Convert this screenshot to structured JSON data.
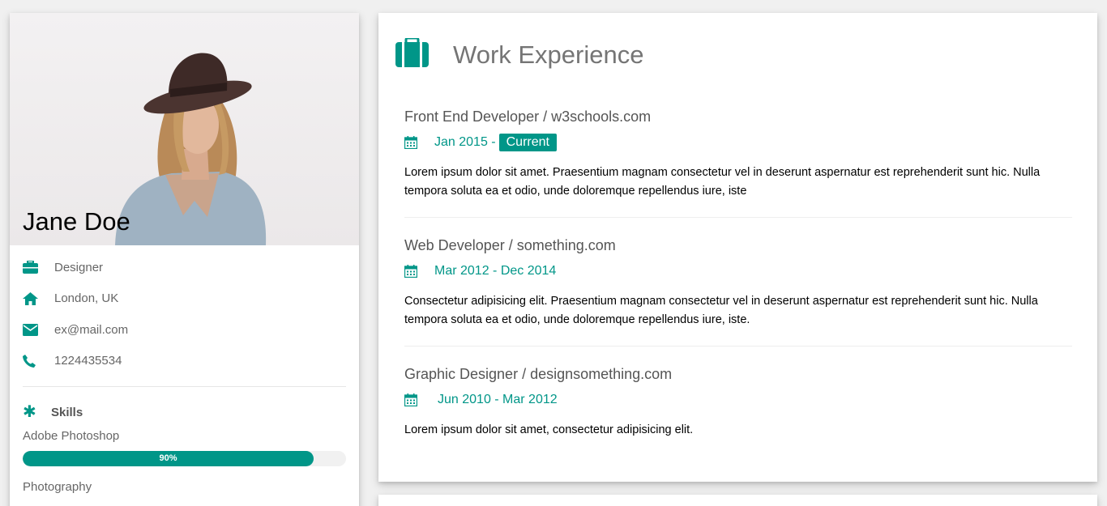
{
  "profile": {
    "name": "Jane Doe",
    "info": [
      {
        "icon": "briefcase-icon",
        "text": "Designer"
      },
      {
        "icon": "home-icon",
        "text": "London, UK"
      },
      {
        "icon": "envelope-icon",
        "text": "ex@mail.com"
      },
      {
        "icon": "phone-icon",
        "text": "1224435534"
      }
    ],
    "skills_label": "Skills",
    "skills": [
      {
        "name": "Adobe Photoshop",
        "percent": 90,
        "label": "90%"
      },
      {
        "name": "Photography"
      }
    ]
  },
  "work": {
    "title": "Work Experience",
    "jobs": [
      {
        "title": "Front End Developer / w3schools.com",
        "date": "Jan 2015 - ",
        "tag": "Current",
        "desc": "Lorem ipsum dolor sit amet. Praesentium magnam consectetur vel in deserunt aspernatur est reprehenderit sunt hic. Nulla tempora soluta ea et odio, unde doloremque repellendus iure, iste"
      },
      {
        "title": "Web Developer / something.com",
        "date": "Mar 2012 - Dec 2014",
        "desc": "Consectetur adipisicing elit. Praesentium magnam consectetur vel in deserunt aspernatur est reprehenderit sunt hic. Nulla tempora soluta ea et odio, unde doloremque repellendus iure, iste."
      },
      {
        "title": "Graphic Designer / designsomething.com",
        "date": "Jun 2010 - Mar 2012",
        "desc": "Lorem ipsum dolor sit amet, consectetur adipisicing elit."
      }
    ]
  },
  "colors": {
    "accent": "#009688",
    "background": "#f0f0f0"
  }
}
